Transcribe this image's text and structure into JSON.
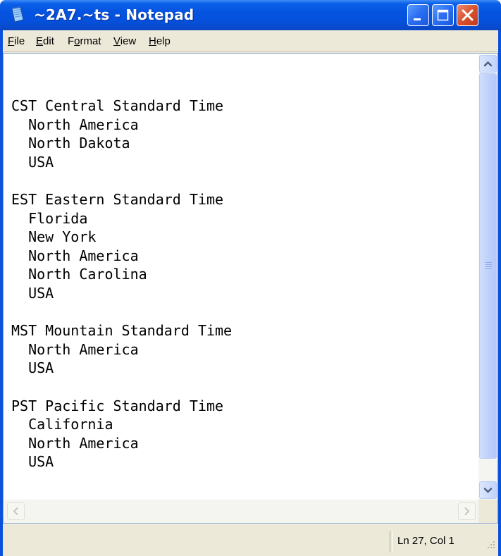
{
  "window": {
    "title": "~2A7.~ts - Notepad"
  },
  "menu": [
    {
      "label_ul": "F",
      "label_rest": "ile"
    },
    {
      "label_ul": "E",
      "label_rest": "dit"
    },
    {
      "label_pre": "F",
      "label_ul": "o",
      "label_rest": "rmat"
    },
    {
      "label_ul": "V",
      "label_rest": "iew"
    },
    {
      "label_ul": "H",
      "label_rest": "elp"
    }
  ],
  "document": {
    "lines": [
      "CST Central Standard Time",
      "  North America",
      "  North Dakota",
      "  USA",
      "",
      "EST Eastern Standard Time",
      "  Florida",
      "  New York",
      "  North America",
      "  North Carolina",
      "  USA",
      "",
      "MST Mountain Standard Time",
      "  North America",
      "  USA",
      "",
      "PST Pacific Standard Time",
      "  California",
      "  North America",
      "  USA"
    ]
  },
  "status": {
    "cursor": "Ln 27, Col 1"
  },
  "icons": {
    "app": "notepad-icon",
    "minimize": "minimize-icon",
    "maximize": "maximize-icon",
    "close": "close-icon"
  },
  "colors": {
    "titlebar": "#0553e0",
    "close_button": "#d9512c",
    "frame": "#ece9d8",
    "scrollbar": "#c0d2fb"
  }
}
